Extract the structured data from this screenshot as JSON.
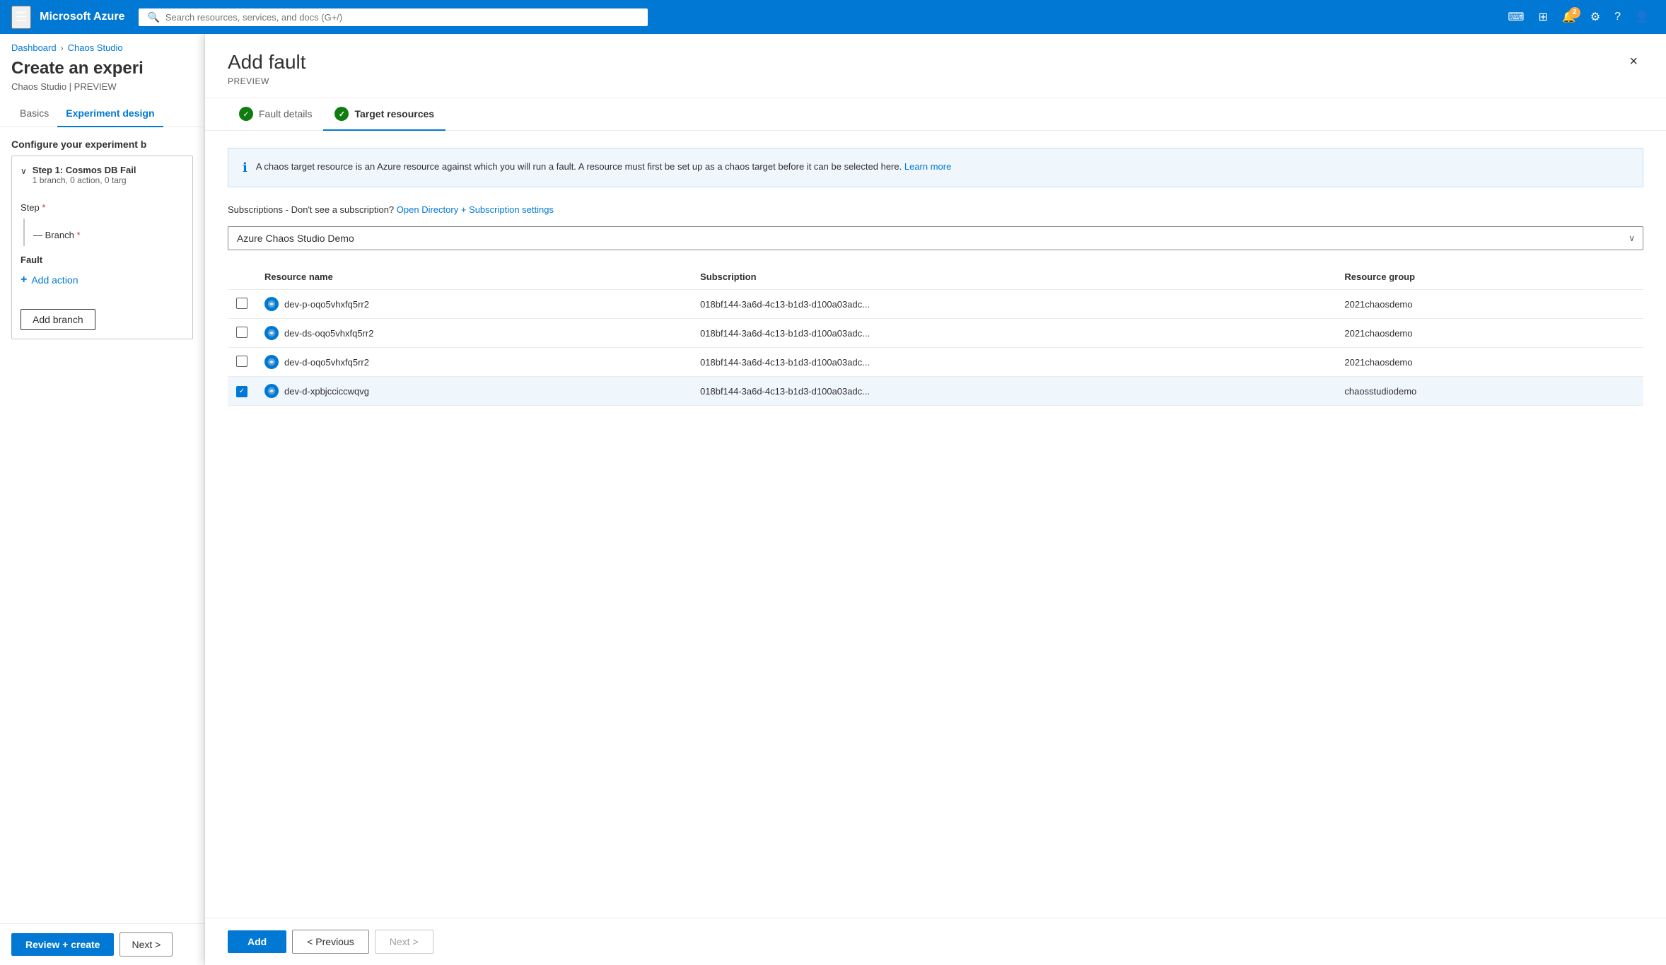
{
  "topbar": {
    "brand": "Microsoft Azure",
    "search_placeholder": "Search resources, services, and docs (G+/)",
    "notification_count": "2"
  },
  "breadcrumb": {
    "dashboard": "Dashboard",
    "chaos_studio": "Chaos Studio"
  },
  "page": {
    "title": "Create an experi",
    "subtitle": "Chaos Studio | PREVIEW"
  },
  "tabs": {
    "basics": "Basics",
    "experiment_design": "Experiment design"
  },
  "configure_label": "Configure your experiment b",
  "step_card": {
    "name": "Step 1: Cosmos DB Fail",
    "meta": "1 branch, 0 action, 0 targ",
    "step_label": "Step",
    "branch_label": "Branch",
    "fault_label": "Fault",
    "add_action_label": "Add action",
    "add_branch_label": "Add branch"
  },
  "bottom_actions": {
    "review_create": "Review + create",
    "next": "Next >"
  },
  "drawer": {
    "title": "Add fault",
    "subtitle": "PREVIEW",
    "close_label": "×",
    "tabs": [
      {
        "id": "fault-details",
        "label": "Fault details",
        "completed": true
      },
      {
        "id": "target-resources",
        "label": "Target resources",
        "completed": true,
        "active": true
      }
    ],
    "info_text": "A chaos target resource is an Azure resource against which you will run a fault. A resource must first be set up as a chaos target before it can be selected here.",
    "learn_more": "Learn more",
    "subscription_label": "Subscriptions - Don't see a subscription?",
    "open_directory_link": "Open Directory + Subscription settings",
    "selected_subscription": "Azure Chaos Studio Demo",
    "table": {
      "columns": [
        "Resource name",
        "Subscription",
        "Resource group"
      ],
      "rows": [
        {
          "id": 1,
          "name": "dev-p-oqo5vhxfq5rr2",
          "subscription": "018bf144-3a6d-4c13-b1d3-d100a03adc...",
          "resource_group": "2021chaosdemo",
          "selected": false
        },
        {
          "id": 2,
          "name": "dev-ds-oqo5vhxfq5rr2",
          "subscription": "018bf144-3a6d-4c13-b1d3-d100a03adc...",
          "resource_group": "2021chaosdemo",
          "selected": false
        },
        {
          "id": 3,
          "name": "dev-d-oqo5vhxfq5rr2",
          "subscription": "018bf144-3a6d-4c13-b1d3-d100a03adc...",
          "resource_group": "2021chaosdemo",
          "selected": false
        },
        {
          "id": 4,
          "name": "dev-d-xpbjcciccwqvg",
          "subscription": "018bf144-3a6d-4c13-b1d3-d100a03adc...",
          "resource_group": "chaosstudiodemo",
          "selected": true
        }
      ]
    },
    "footer": {
      "add_label": "Add",
      "previous_label": "< Previous",
      "next_label": "Next >"
    }
  }
}
